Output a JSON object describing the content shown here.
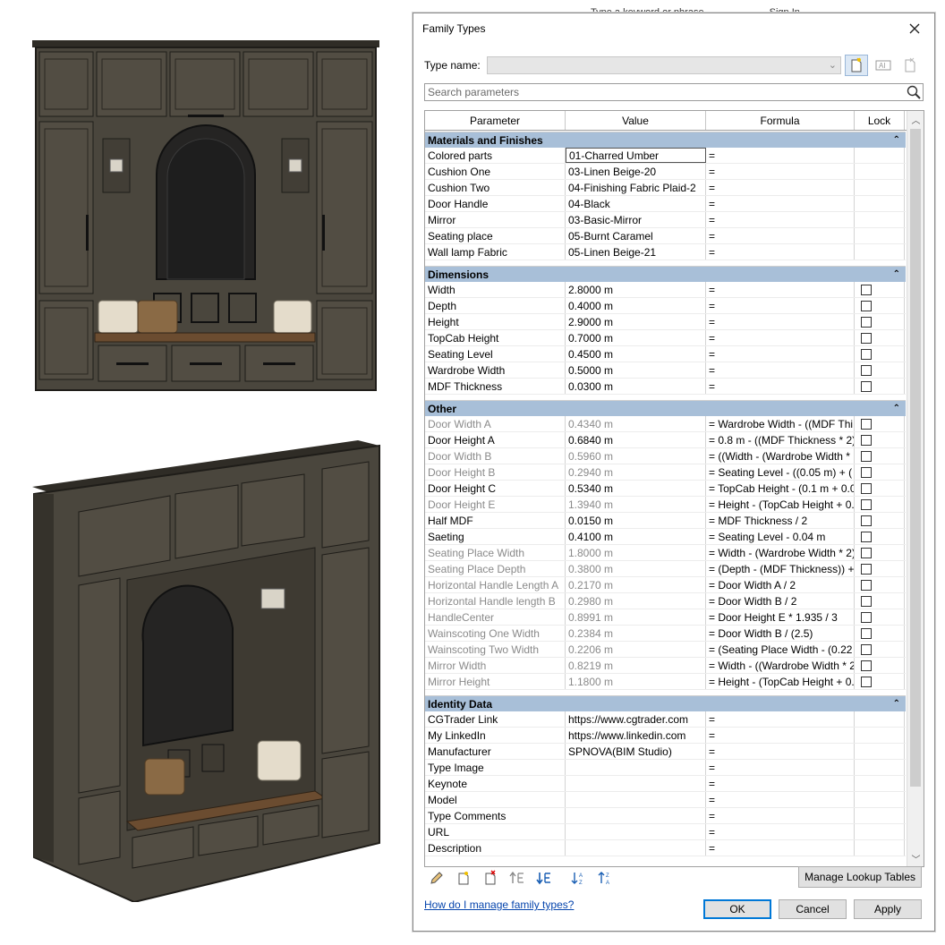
{
  "background": {
    "strip_text_1": "Type a keyword or phrase",
    "strip_text_2": "Sign In"
  },
  "dialog": {
    "title": "Family Types",
    "type_name_label": "Type name:",
    "type_name_value": "",
    "search_placeholder": "Search parameters",
    "columns": {
      "parameter": "Parameter",
      "value": "Value",
      "formula": "Formula",
      "lock": "Lock"
    },
    "groups": [
      {
        "name": "Materials and Finishes",
        "rows": [
          {
            "param": "Colored parts",
            "value": "01-Charred Umber",
            "formula": "=",
            "lock": false,
            "disabled": false,
            "selected": true
          },
          {
            "param": "Cushion One",
            "value": "03-Linen Beige-20",
            "formula": "=",
            "lock": false,
            "disabled": false
          },
          {
            "param": "Cushion Two",
            "value": "04-Finishing Fabric Plaid-2",
            "formula": "=",
            "lock": false,
            "disabled": false
          },
          {
            "param": "Door Handle",
            "value": "04-Black",
            "formula": "=",
            "lock": false,
            "disabled": false
          },
          {
            "param": "Mirror",
            "value": "03-Basic-Mirror",
            "formula": "=",
            "lock": false,
            "disabled": false
          },
          {
            "param": "Seating place",
            "value": "05-Burnt Caramel",
            "formula": "=",
            "lock": false,
            "disabled": false
          },
          {
            "param": "Wall lamp Fabric",
            "value": "05-Linen Beige-21",
            "formula": "=",
            "lock": false,
            "disabled": false
          }
        ]
      },
      {
        "name": "Dimensions",
        "rows": [
          {
            "param": "Width",
            "value": "2.8000 m",
            "formula": "=",
            "lock": true,
            "disabled": false
          },
          {
            "param": "Depth",
            "value": "0.4000 m",
            "formula": "=",
            "lock": true,
            "disabled": false
          },
          {
            "param": "Height",
            "value": "2.9000 m",
            "formula": "=",
            "lock": true,
            "disabled": false
          },
          {
            "param": "TopCab Height",
            "value": "0.7000 m",
            "formula": "=",
            "lock": true,
            "disabled": false
          },
          {
            "param": "Seating Level",
            "value": "0.4500 m",
            "formula": "=",
            "lock": true,
            "disabled": false
          },
          {
            "param": "Wardrobe Width",
            "value": "0.5000 m",
            "formula": "=",
            "lock": true,
            "disabled": false
          },
          {
            "param": "MDF Thickness",
            "value": "0.0300 m",
            "formula": "=",
            "lock": true,
            "disabled": false
          }
        ]
      },
      {
        "name": "Other",
        "rows": [
          {
            "param": "Door Width A",
            "value": "0.4340 m",
            "formula": "= Wardrobe Width - ((MDF Thi",
            "lock": true,
            "disabled": true
          },
          {
            "param": "Door Height A",
            "value": "0.6840 m",
            "formula": "= 0.8 m - ((MDF Thickness * 2)",
            "lock": true,
            "disabled": false
          },
          {
            "param": "Door Width B",
            "value": "0.5960 m",
            "formula": "= ((Width - (Wardrobe Width *",
            "lock": true,
            "disabled": true
          },
          {
            "param": "Door Height B",
            "value": "0.2940 m",
            "formula": "= Seating Level - ((0.05 m) + (",
            "lock": true,
            "disabled": true
          },
          {
            "param": "Door Height C",
            "value": "0.5340 m",
            "formula": "= TopCab Height - (0.1 m + 0.0",
            "lock": true,
            "disabled": false
          },
          {
            "param": "Door Height E",
            "value": "1.3940 m",
            "formula": "= Height - (TopCab Height + 0.",
            "lock": true,
            "disabled": true
          },
          {
            "param": "Half MDF",
            "value": "0.0150 m",
            "formula": "= MDF Thickness / 2",
            "lock": true,
            "disabled": false
          },
          {
            "param": "Saeting",
            "value": "0.4100 m",
            "formula": "= Seating Level - 0.04 m",
            "lock": true,
            "disabled": false
          },
          {
            "param": "Seating Place Width",
            "value": "1.8000 m",
            "formula": "= Width - (Wardrobe Width * 2)",
            "lock": true,
            "disabled": true
          },
          {
            "param": "Seating Place Depth",
            "value": "0.3800 m",
            "formula": "= (Depth - (MDF Thickness)) +",
            "lock": true,
            "disabled": true
          },
          {
            "param": "Horizontal Handle Length A",
            "value": "0.2170 m",
            "formula": "= Door Width A / 2",
            "lock": true,
            "disabled": true
          },
          {
            "param": "Horizontal Handle length B",
            "value": "0.2980 m",
            "formula": "= Door Width B / 2",
            "lock": true,
            "disabled": true
          },
          {
            "param": "HandleCenter",
            "value": "0.8991 m",
            "formula": "= Door Height E * 1.935 / 3",
            "lock": true,
            "disabled": true
          },
          {
            "param": "Wainscoting One Width",
            "value": "0.2384 m",
            "formula": "= Door Width B / (2.5)",
            "lock": true,
            "disabled": true
          },
          {
            "param": "Wainscoting Two Width",
            "value": "0.2206 m",
            "formula": "= (Seating Place Width - (0.22",
            "lock": true,
            "disabled": true
          },
          {
            "param": "Mirror Width",
            "value": "0.8219 m",
            "formula": "= Width - ((Wardrobe Width * 2",
            "lock": true,
            "disabled": true
          },
          {
            "param": "Mirror Height",
            "value": "1.1800 m",
            "formula": "= Height - (TopCab Height + 0.",
            "lock": true,
            "disabled": true
          }
        ]
      },
      {
        "name": "Identity Data",
        "rows": [
          {
            "param": "CGTrader Link",
            "value": "https://www.cgtrader.com",
            "formula": "=",
            "lock": false,
            "disabled": false
          },
          {
            "param": "My LinkedIn",
            "value": "https://www.linkedin.com",
            "formula": "=",
            "lock": false,
            "disabled": false
          },
          {
            "param": "Manufacturer",
            "value": "SPNOVA(BIM Studio)",
            "formula": "=",
            "lock": false,
            "disabled": false
          },
          {
            "param": "Type Image",
            "value": "",
            "formula": "=",
            "lock": false,
            "disabled": false
          },
          {
            "param": "Keynote",
            "value": "",
            "formula": "=",
            "lock": false,
            "disabled": false
          },
          {
            "param": "Model",
            "value": "",
            "formula": "=",
            "lock": false,
            "disabled": false
          },
          {
            "param": "Type Comments",
            "value": "",
            "formula": "=",
            "lock": false,
            "disabled": false
          },
          {
            "param": "URL",
            "value": "",
            "formula": "=",
            "lock": false,
            "disabled": false
          },
          {
            "param": "Description",
            "value": "",
            "formula": "=",
            "lock": false,
            "disabled": false
          }
        ]
      }
    ],
    "manage_lookup_label": "Manage Lookup Tables",
    "help_link": "How do I manage family types?",
    "ok_label": "OK",
    "cancel_label": "Cancel",
    "apply_label": "Apply"
  },
  "colors": {
    "group_header": "#a8bfd8",
    "cabinet_dark": "#3b3830",
    "cabinet_face": "#4a463d",
    "cushion_light": "#e4dccb",
    "cushion_brown": "#8a6a45",
    "seat_brown": "#6b4c30",
    "link_blue": "#0645ad"
  }
}
